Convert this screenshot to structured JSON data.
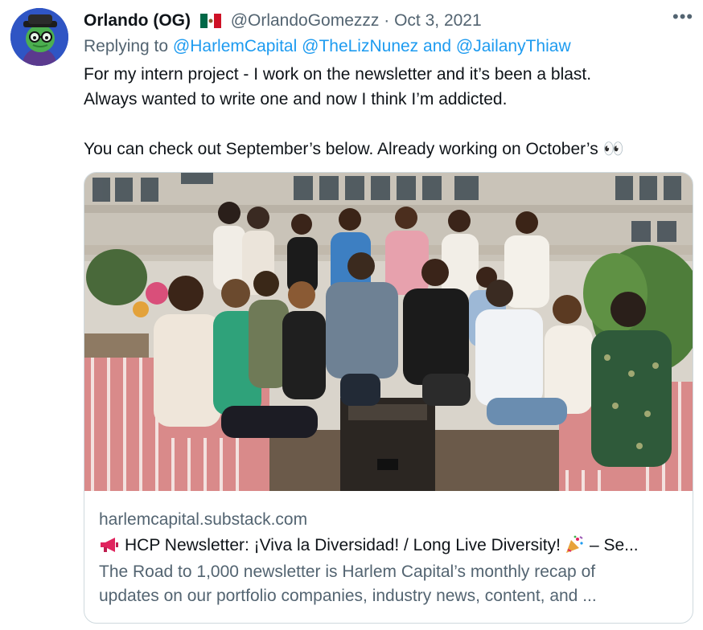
{
  "tweet": {
    "author": {
      "display_name": "Orlando (OG)",
      "handle": "@OrlandoGomezzz",
      "flag_icon": "mexico-flag-icon"
    },
    "separator": "·",
    "date": "Oct 3, 2021",
    "more_icon": "more-horizontal-icon",
    "more_label": "•••",
    "reply": {
      "prefix": "Replying to",
      "mention_1": "@HarlemCapital",
      "mention_2": "@TheLizNunez",
      "and": "and",
      "mention_3": "@JailanyThiaw"
    },
    "text": "For my intern project - I work on the newsletter and it’s been a blast.\nAlways wanted to write one and now I think I’m addicted.\n\nYou can check out September’s below. Already working on October’s 👀"
  },
  "card": {
    "domain": "harlemcapital.substack.com",
    "title_icon": "megaphone-icon",
    "title_part_1": "HCP Newsletter: ¡Viva la Diversidad! / Long Live Diversity!",
    "title_emoji_icon": "party-popper-icon",
    "title_part_2": "– Se...",
    "description_line_1": "The Road to 1,000 newsletter is Harlem Capital’s monthly recap of",
    "description_line_2": "updates on our portfolio companies, industry news, content, and ..."
  },
  "colors": {
    "link": "#1d9bf0",
    "secondary_text": "#536471",
    "primary_text": "#0f1419",
    "border": "#cfd9de"
  }
}
